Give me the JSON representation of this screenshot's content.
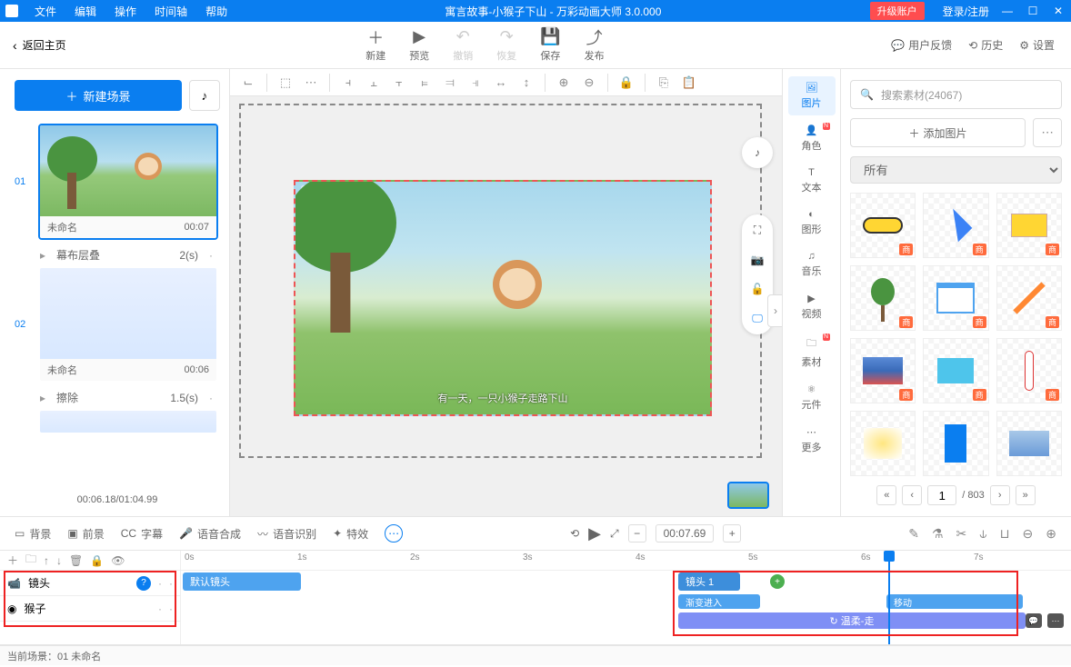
{
  "titlebar": {
    "menus": [
      "文件",
      "编辑",
      "操作",
      "时间轴",
      "帮助"
    ],
    "title": "寓言故事-小猴子下山 - 万彩动画大师 3.0.000",
    "upgrade": "升级账户",
    "login": "登录/注册"
  },
  "toolbar": {
    "back": "返回主页",
    "actions": [
      {
        "label": "新建",
        "icon": "＋"
      },
      {
        "label": "预览",
        "icon": "▶"
      },
      {
        "label": "撤销",
        "icon": "↶",
        "disabled": true
      },
      {
        "label": "恢复",
        "icon": "↷",
        "disabled": true
      },
      {
        "label": "保存",
        "icon": "💾"
      },
      {
        "label": "发布",
        "icon": "⤴"
      }
    ],
    "right": [
      {
        "label": "用户反馈",
        "icon": "💬"
      },
      {
        "label": "历史",
        "icon": "⟲"
      },
      {
        "label": "设置",
        "icon": "⚙"
      }
    ]
  },
  "scenes": {
    "new_btn": "新建场景",
    "list": [
      {
        "num": "01",
        "name": "未命名",
        "time": "00:07",
        "selected": true,
        "transition": "幕布层叠",
        "t_time": "2(s)"
      },
      {
        "num": "02",
        "name": "未命名",
        "time": "00:06",
        "blank": true,
        "transition": "擦除",
        "t_time": "1.5(s)"
      }
    ],
    "footer_time": "00:06.18/01:04.99"
  },
  "canvas": {
    "subtitle": "有一天，一只小猴子走路下山"
  },
  "right_tabs": [
    {
      "label": "图片",
      "icon": "🖼",
      "active": true
    },
    {
      "label": "角色",
      "icon": "👤",
      "badge": true
    },
    {
      "label": "文本",
      "icon": "T"
    },
    {
      "label": "图形",
      "icon": "◐"
    },
    {
      "label": "音乐",
      "icon": "♫"
    },
    {
      "label": "视频",
      "icon": "▶"
    },
    {
      "label": "素材",
      "icon": "🗀",
      "badge": true
    },
    {
      "label": "元件",
      "icon": "⚛"
    },
    {
      "label": "更多",
      "icon": "⋯"
    }
  ],
  "assets": {
    "search_placeholder": "搜索素材(24067)",
    "add_btn": "添加图片",
    "category": "所有",
    "badge": "商",
    "page": "1",
    "total_pages": "803"
  },
  "timeline_toolbar": {
    "items": [
      "背景",
      "前景",
      "字幕",
      "语音合成",
      "语音识别",
      "特效"
    ],
    "time": "00:07.69"
  },
  "timeline": {
    "ticks": [
      "0s",
      "1s",
      "2s",
      "3s",
      "4s",
      "5s",
      "6s",
      "7s"
    ],
    "tracks": [
      {
        "name": "镜头",
        "help": true
      },
      {
        "name": "猴子"
      }
    ],
    "segments": {
      "default_cam": "默认镜头",
      "cam1": "镜头 1",
      "fade_in": "渐变进入",
      "move": "移动",
      "walk": "↻ 温柔-走"
    }
  },
  "statusbar": "当前场景：01   未命名"
}
